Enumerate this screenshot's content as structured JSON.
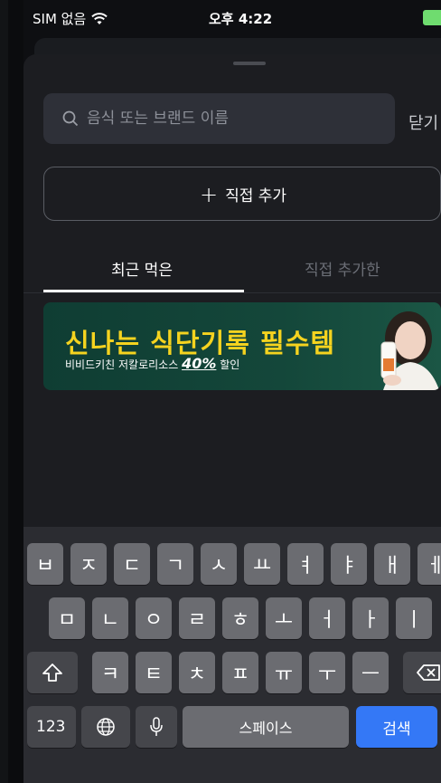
{
  "status_bar": {
    "carrier": "SIM 없음",
    "time": "오후 4:22"
  },
  "search": {
    "placeholder": "음식 또는 브랜드 이름",
    "close_label": "닫기"
  },
  "add_direct": {
    "label": "직접 추가"
  },
  "tabs": [
    {
      "label": "최근 먹은",
      "active": true
    },
    {
      "label": "직접 추가한",
      "active": false
    }
  ],
  "banner": {
    "title": "신나는 식단기록 필수템",
    "subtitle_prefix": "비비드키친 저칼로리소스",
    "subtitle_percent": "40%",
    "subtitle_suffix": "할인"
  },
  "keyboard": {
    "row1": [
      "ㅂ",
      "ㅈ",
      "ㄷ",
      "ㄱ",
      "ㅅ",
      "ㅛ",
      "ㅕ",
      "ㅑ",
      "ㅐ",
      "ㅔ"
    ],
    "row2": [
      "ㅁ",
      "ㄴ",
      "ㅇ",
      "ㄹ",
      "ㅎ",
      "ㅗ",
      "ㅓ",
      "ㅏ",
      "ㅣ"
    ],
    "row3": [
      "ㅋ",
      "ㅌ",
      "ㅊ",
      "ㅍ",
      "ㅠ",
      "ㅜ",
      "ㅡ"
    ],
    "numbers_label": "123",
    "space_label": "스페이스",
    "return_label": "검색"
  },
  "colors": {
    "accent_blue": "#3478f6",
    "banner_yellow": "#f5d31f",
    "battery_green": "#6fdc6f"
  }
}
